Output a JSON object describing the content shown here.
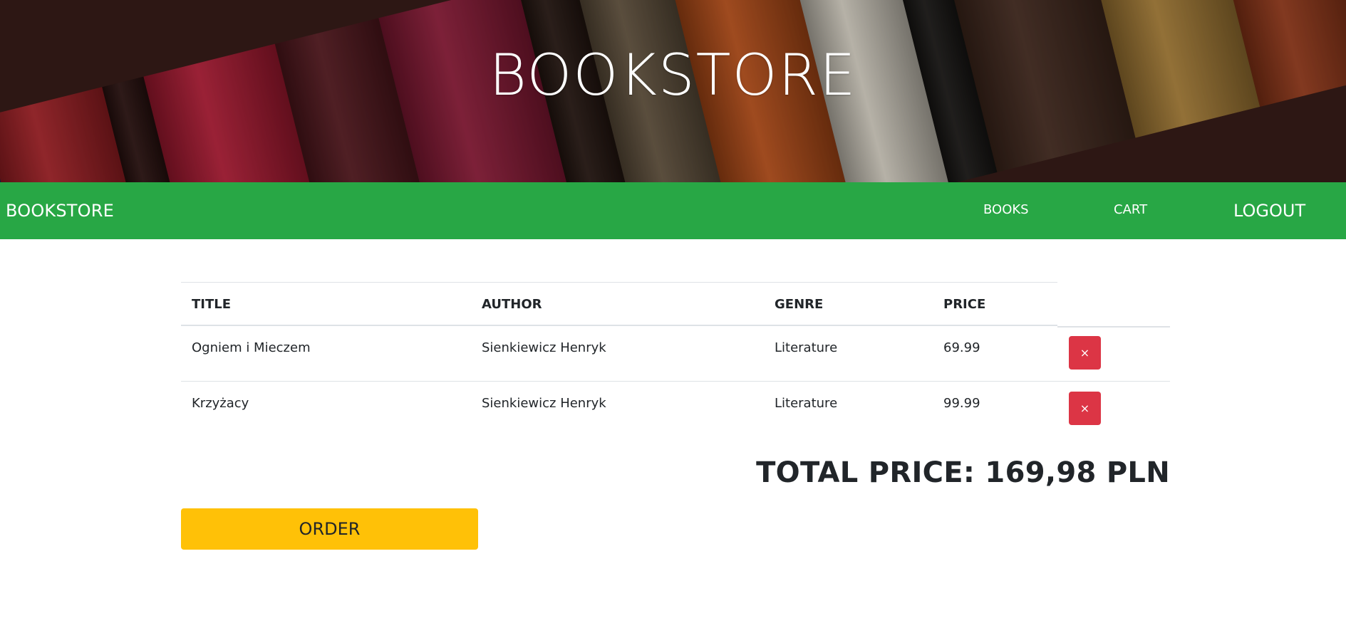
{
  "hero": {
    "title": "BOOKSTORE"
  },
  "navbar": {
    "brand": "BOOKSTORE",
    "links": {
      "books": "BOOKS",
      "cart": "CART",
      "logout": "LOGOUT"
    },
    "background_color": "#28a745"
  },
  "cart": {
    "headers": {
      "title": "TITLE",
      "author": "AUTHOR",
      "genre": "GENRE",
      "price": "PRICE"
    },
    "rows": [
      {
        "title": "Ogniem i Mieczem",
        "author": "Sienkiewicz Henryk",
        "genre": "Literature",
        "price": "69.99",
        "remove_icon": "×"
      },
      {
        "title": "Krzyżacy",
        "author": "Sienkiewicz Henryk",
        "genre": "Literature",
        "price": "99.99",
        "remove_icon": "×"
      }
    ],
    "total": "TOTAL PRICE: 169,98 PLN",
    "order_label": "ORDER",
    "remove_button_color": "#dc3545",
    "order_button_color": "#ffc107"
  }
}
